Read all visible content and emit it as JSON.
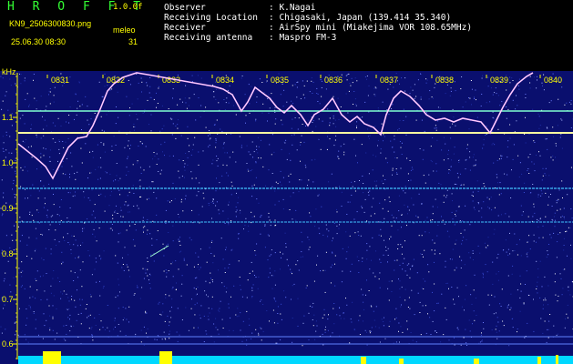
{
  "header": {
    "app_title": "H R O F F T",
    "version": "1.0.0f",
    "filename": "KN9_2506300830.png",
    "meleo_label": "meleo",
    "datetime": "25.06.30 08:30",
    "meleo_value": "31"
  },
  "meta": [
    {
      "key": "Observer",
      "value": ": K.Nagai"
    },
    {
      "key": "Receiving Location",
      "value": ": Chigasaki, Japan (139.414 35.340)"
    },
    {
      "key": "Receiver",
      "value": ": AirSpy mini (Miakejima VOR 108.65MHz)"
    },
    {
      "key": "Receiving antenna",
      "value": ": Maspro FM-3"
    }
  ],
  "axis": {
    "unit_label": "kHz",
    "y_ticks": [
      "1.1",
      "1.0",
      "0.9",
      "0.8",
      "0.7",
      "0.6"
    ],
    "time_ticks": [
      "0831",
      "0832",
      "0833",
      "0834",
      "0835",
      "0836",
      "0837",
      "0838",
      "0839",
      "0840"
    ]
  },
  "colors": {
    "background_noise": "#0a0f6e",
    "header_text_yellow": "#ffff00",
    "title_green": "#33ff33",
    "carrier_line": "#9fffd0",
    "echo_trace": "#ffb0ff",
    "bottom_band": "#00d8ff"
  }
}
